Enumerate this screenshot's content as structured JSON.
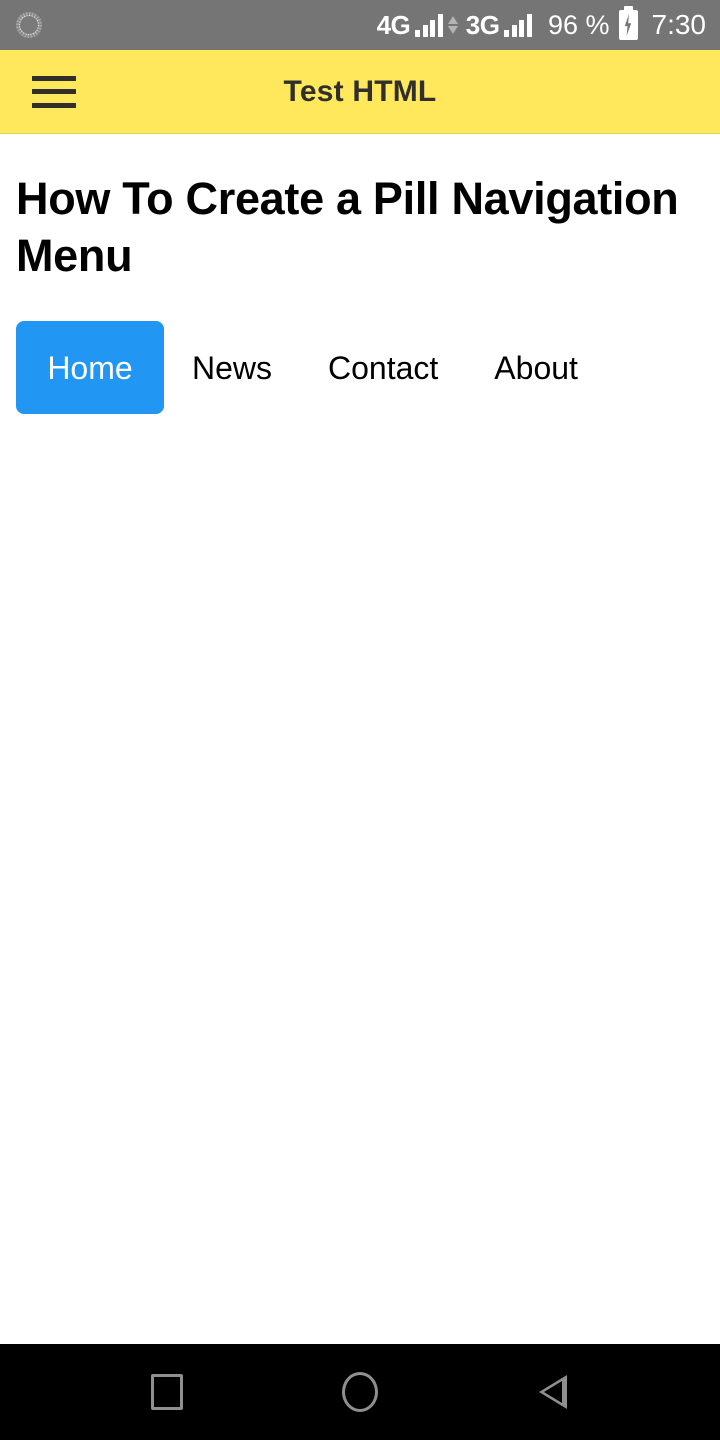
{
  "status_bar": {
    "background_color": "#757575",
    "left_icon": "spinner-icon",
    "networks": [
      {
        "label": "4G",
        "signal_bars": 4
      },
      {
        "label": "3G",
        "signal_bars": 4
      }
    ],
    "data_activity_icon": "data-transfer-arrows-icon",
    "battery_percent": "96 %",
    "battery_icon": "battery-charging-icon",
    "clock": "7:30"
  },
  "app_bar": {
    "background_color": "#FFE85C",
    "menu_icon": "hamburger-menu-icon",
    "title": "Test HTML",
    "title_color": "#302F2C"
  },
  "content": {
    "heading": "How To Create a Pill Navigation Menu",
    "pill_nav": {
      "active_color": "#2196F3",
      "active_text_color": "#FFFFFF",
      "items": [
        {
          "label": "Home",
          "active": true
        },
        {
          "label": "News",
          "active": false
        },
        {
          "label": "Contact",
          "active": false
        },
        {
          "label": "About",
          "active": false
        }
      ]
    }
  },
  "navigation_bar": {
    "background_color": "#000000",
    "icon_color": "#8F8F8F",
    "buttons": [
      {
        "name": "recents",
        "icon": "square-icon"
      },
      {
        "name": "home",
        "icon": "circle-icon"
      },
      {
        "name": "back",
        "icon": "triangle-left-icon"
      }
    ]
  }
}
